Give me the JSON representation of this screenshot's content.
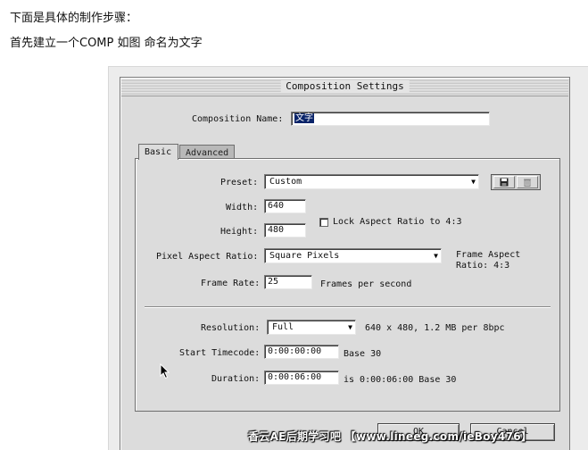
{
  "article": {
    "line1": "下面是具体的制作步骤：",
    "line2": "首先建立一个COMP 如图 命名为文字"
  },
  "dialog": {
    "title": "Composition Settings",
    "composition_name_label": "Composition Name:",
    "composition_name_value": "文字",
    "tabs": [
      {
        "label": "Basic",
        "active": true
      },
      {
        "label": "Advanced",
        "active": false
      }
    ],
    "preset": {
      "label": "Preset:",
      "value": "Custom",
      "icons": [
        "save-icon",
        "trash-icon"
      ]
    },
    "width": {
      "label": "Width:",
      "value": "640"
    },
    "height": {
      "label": "Height:",
      "value": "480"
    },
    "lock_aspect": {
      "label": "Lock Aspect Ratio to 4:3",
      "checked": false
    },
    "pixel_aspect": {
      "label": "Pixel Aspect Ratio:",
      "value": "Square Pixels"
    },
    "frame_aspect": {
      "line1": "Frame Aspect",
      "line2": "Ratio: 4:3"
    },
    "frame_rate": {
      "label": "Frame Rate:",
      "value": "25",
      "unit": "Frames per second"
    },
    "resolution": {
      "label": "Resolution:",
      "value": "Full",
      "info": "640 x 480, 1.2 MB per 8bpc"
    },
    "start_timecode": {
      "label": "Start Timecode:",
      "value": "0:00:00:00",
      "base": "Base 30"
    },
    "duration": {
      "label": "Duration:",
      "value": "0:00:06:00",
      "info": "is 0:00:06:00  Base 30"
    },
    "ok_label": "OK",
    "cancel_label": "Cancel"
  },
  "watermark": "香云AE后期学习吧 【www.lineeg.com/ieBoy476】"
}
